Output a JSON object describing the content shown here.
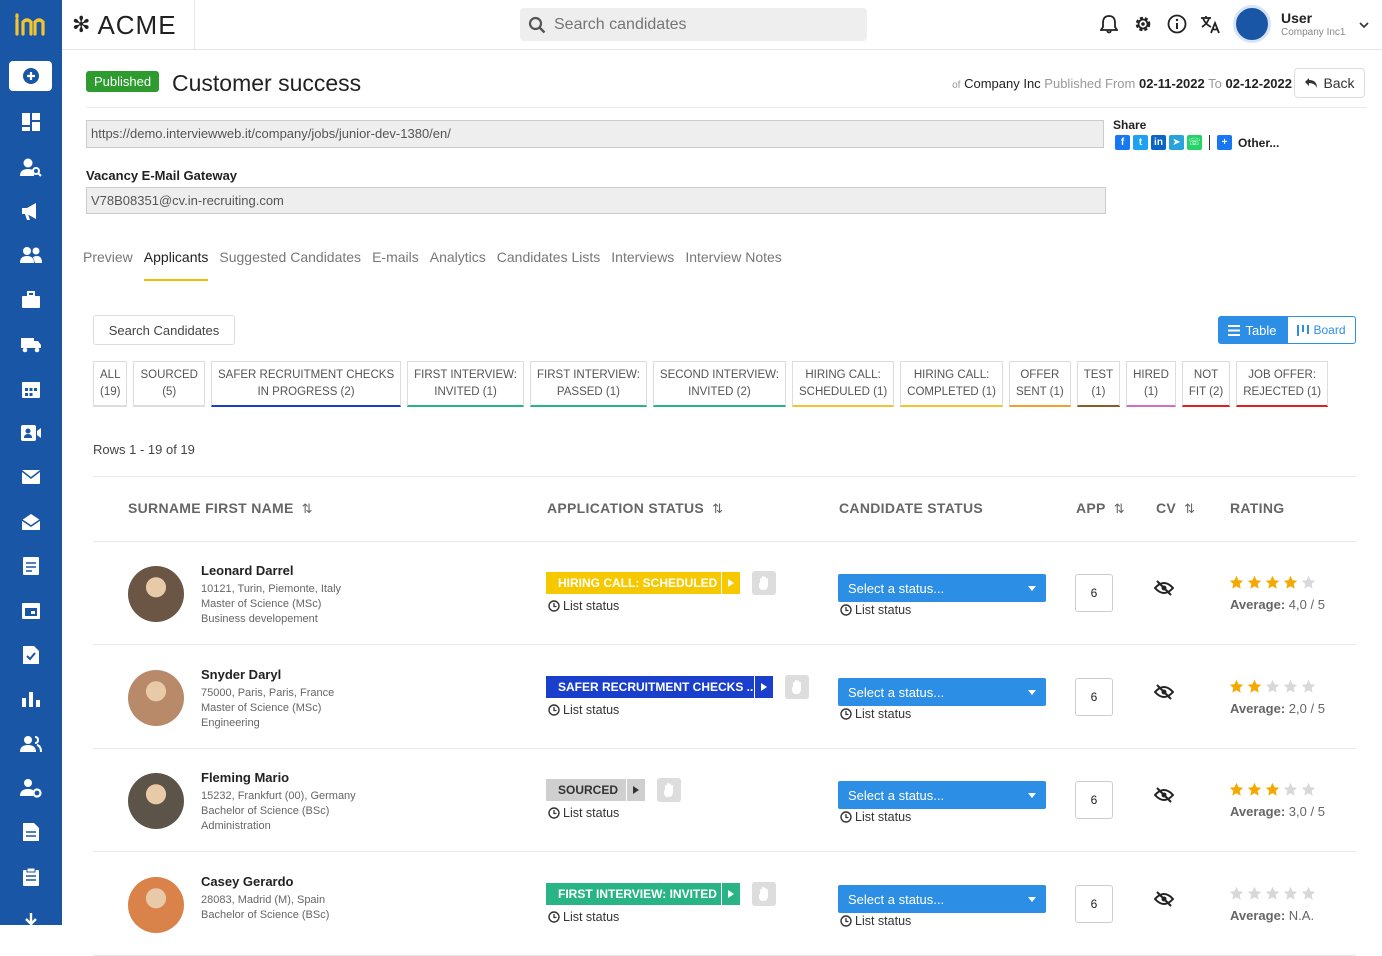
{
  "brand": {
    "name": "ACME"
  },
  "search": {
    "placeholder": "Search candidates"
  },
  "user": {
    "name": "User",
    "company": "Company Inc1"
  },
  "job": {
    "status_badge": "Published",
    "title": "Customer success",
    "meta_of": "of",
    "company": "Company Inc",
    "published_from_label": "Published From",
    "date_from": "02-11-2022",
    "to_label": "To",
    "date_to": "02-12-2022",
    "back_label": "Back",
    "url": "https://demo.interviewweb.it/company/jobs/junior-dev-1380/en/",
    "share_label": "Share",
    "share_other": "Other...",
    "gateway_label": "Vacancy E-Mail Gateway",
    "gateway_email": "V78B08351@cv.in-recruiting.com"
  },
  "tabs": [
    "Preview",
    "Applicants",
    "Suggested Candidates",
    "E-mails",
    "Analytics",
    "Candidates Lists",
    "Interviews",
    "Interview Notes"
  ],
  "active_tab": "Applicants",
  "search_candidates_label": "Search Candidates",
  "view_toggle": {
    "table": "Table",
    "board": "Board"
  },
  "filters": [
    {
      "l1": "ALL",
      "l2": "(19)",
      "color": "#dddddd"
    },
    {
      "l1": "SOURCED",
      "l2": "(5)",
      "color": "#dddddd"
    },
    {
      "l1": "SAFER RECRUITMENT CHECKS",
      "l2": "IN PROGRESS (2)",
      "color": "#1a3fcc"
    },
    {
      "l1": "FIRST INTERVIEW:",
      "l2": "INVITED (1)",
      "color": "#28b485"
    },
    {
      "l1": "FIRST INTERVIEW:",
      "l2": "PASSED (1)",
      "color": "#28b485"
    },
    {
      "l1": "SECOND INTERVIEW:",
      "l2": "INVITED (2)",
      "color": "#28b485"
    },
    {
      "l1": "HIRING CALL:",
      "l2": "SCHEDULED (1)",
      "color": "#f4c430"
    },
    {
      "l1": "HIRING CALL:",
      "l2": "COMPLETED (1)",
      "color": "#f4c430"
    },
    {
      "l1": "OFFER",
      "l2": "SENT (1)",
      "color": "#f4a030"
    },
    {
      "l1": "TEST",
      "l2": "(1)",
      "color": "#8a5c2a"
    },
    {
      "l1": "HIRED",
      "l2": "(1)",
      "color": "#d070c0"
    },
    {
      "l1": "NOT",
      "l2": "FIT (2)",
      "color": "#e02020"
    },
    {
      "l1": "JOB OFFER:",
      "l2": "REJECTED (1)",
      "color": "#e02020"
    }
  ],
  "rows_info": "Rows 1 - 19 of 19",
  "columns": {
    "name": "SURNAME FIRST NAME",
    "app_status": "APPLICATION STATUS",
    "cand_status": "CANDIDATE STATUS",
    "app": "APP",
    "cv": "CV",
    "rating": "RATING"
  },
  "list_status_label": "List status",
  "select_status_label": "Select a status...",
  "candidates": [
    {
      "name": "Leonard Darrel",
      "location": "10121, Turin, Piemonte, Italy",
      "degree": "Master of Science (MSc)",
      "field": "Business developement",
      "status": "HIRING CALL: SCHEDULED",
      "status_color": "#f5c800",
      "status_width": 175,
      "app": "6",
      "rating": 4,
      "average_label": "Average:",
      "average": "4,0 / 5"
    },
    {
      "name": "Snyder Daryl",
      "location": "75000, Paris, Paris, France",
      "degree": "Master of Science (MSc)",
      "field": "Engineering",
      "status": "SAFER RECRUITMENT CHECKS ...",
      "status_color": "#1a3fcc",
      "status_width": 208,
      "app": "6",
      "rating": 2,
      "average_label": "Average:",
      "average": "2,0 / 5"
    },
    {
      "name": "Fleming Mario",
      "location": "15232, Frankfurt (00), Germany",
      "degree": "Bachelor of Science (BSc)",
      "field": "Administration",
      "status": "SOURCED",
      "status_color": "#cfcfcf",
      "status_width": 80,
      "app": "6",
      "rating": 3,
      "average_label": "Average:",
      "average": "3,0 / 5"
    },
    {
      "name": "Casey Gerardo",
      "location": "28083, Madrid (M), Spain",
      "degree": "Bachelor of Science (BSc)",
      "field": "",
      "status": "FIRST INTERVIEW: INVITED",
      "status_color": "#28b485",
      "status_width": 175,
      "app": "6",
      "rating": 0,
      "average_label": "Average:",
      "average": "N.A."
    }
  ],
  "colors": {
    "sidebar": "#1a56a6",
    "accent": "#2d8ee6",
    "published": "#2e9b2e",
    "tab_underline": "#f0c000",
    "star_on": "#f4a800",
    "star_off": "#d8d8d8"
  }
}
